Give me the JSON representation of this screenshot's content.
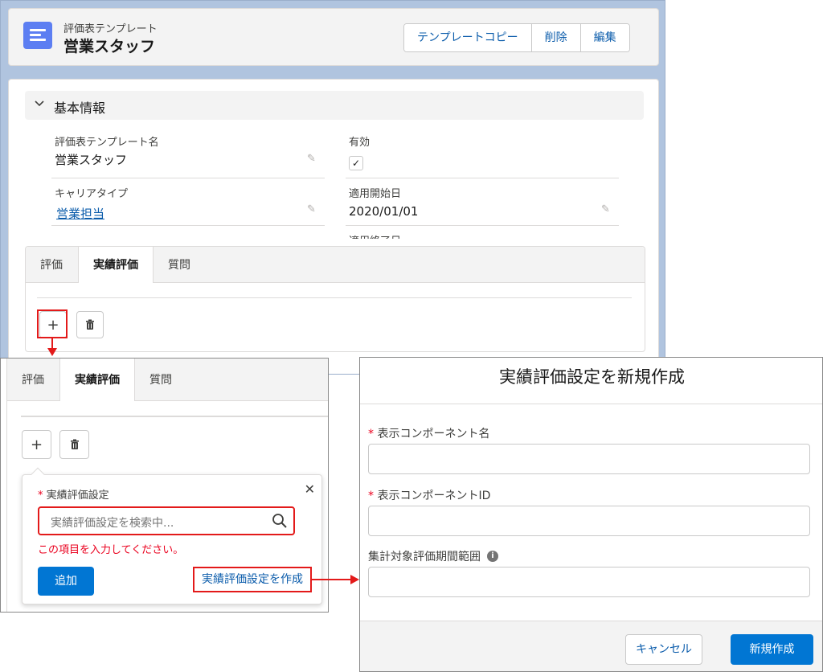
{
  "record": {
    "object_label": "評価表テンプレート",
    "title": "営業スタッフ",
    "actions": [
      "テンプレートコピー",
      "削除",
      "編集"
    ]
  },
  "section": {
    "title": "基本情報",
    "fields": {
      "template_name_label": "評価表テンプレート名",
      "template_name_value": "営業スタッフ",
      "active_label": "有効",
      "active_checked": "✓",
      "career_type_label": "キャリアタイプ",
      "career_type_value": "営業担当",
      "start_date_label": "適用開始日",
      "start_date_value": "2020/01/01",
      "end_date_label": "適用終了日"
    }
  },
  "tabs": [
    "評価",
    "実績評価",
    "質問"
  ],
  "active_tab": "実績評価",
  "toolbar": {
    "add_icon": "+",
    "delete_icon": "trash-icon"
  },
  "popover": {
    "required_mark": "*",
    "field_label": "実績評価設定",
    "search_placeholder": "実績評価設定を検索中...",
    "error": "この項目を入力してください。",
    "add_button": "追加",
    "create_link": "実績評価設定を作成",
    "close": "✕"
  },
  "modal": {
    "title": "実績評価設定を新規作成",
    "required_mark": "*",
    "field1_label": "表示コンポーネント名",
    "field2_label": "表示コンポーネントID",
    "field3_label": "集計対象評価期間範囲",
    "info_icon": "i",
    "cancel_button": "キャンセル",
    "create_button": "新規作成"
  },
  "colors": {
    "brand": "#0176d3",
    "link": "#0b5cab",
    "annotation": "#e31a1a",
    "record_icon": "#5c7ef2"
  }
}
